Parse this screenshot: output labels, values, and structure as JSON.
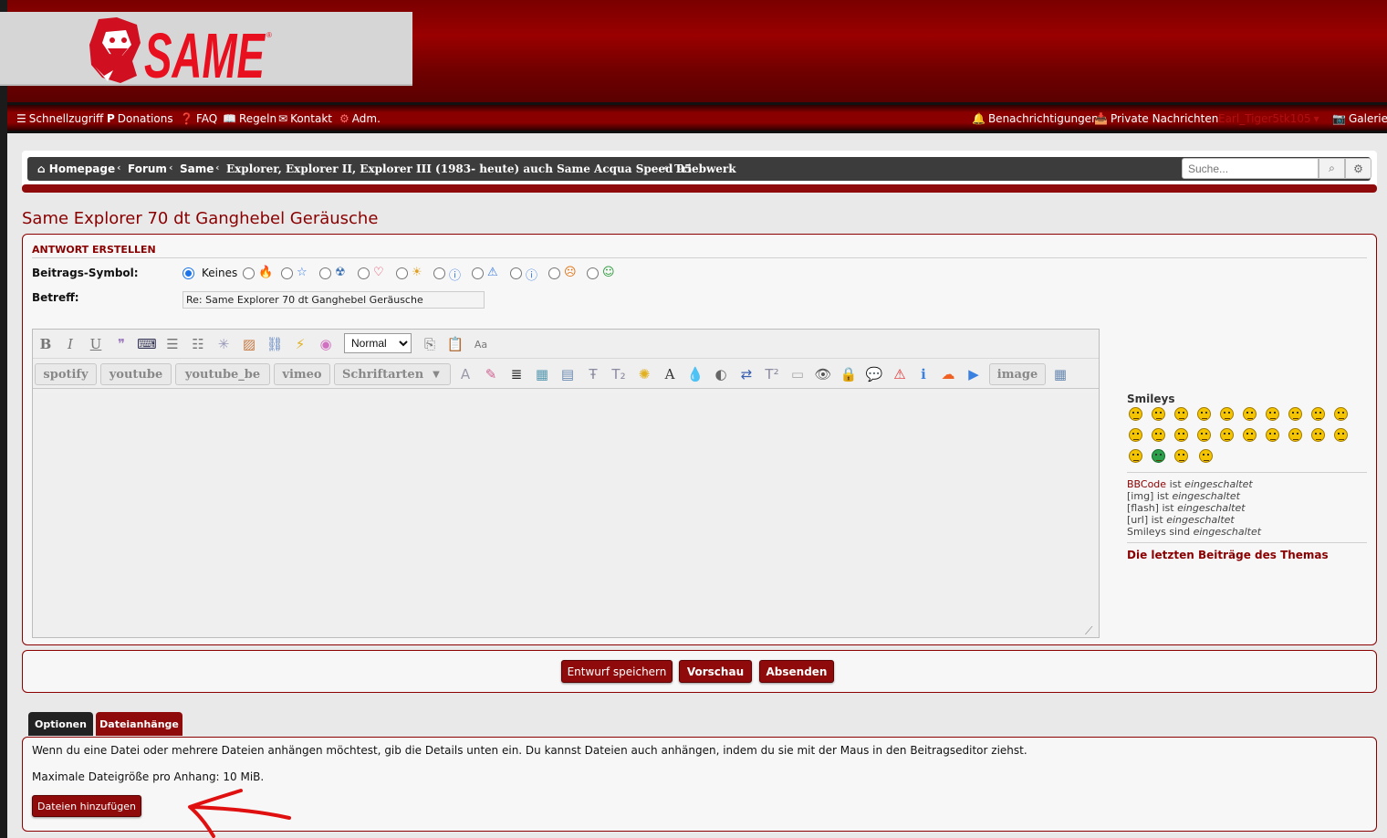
{
  "logo": {
    "text": "SAME"
  },
  "nav": {
    "quick": "Schnellzugriff",
    "donations": "Donations",
    "faq": "FAQ",
    "rules": "Regeln",
    "contact": "Kontakt",
    "admin": "Adm.",
    "notifications": "Benachrichtigungen",
    "pm": "Private Nachrichten",
    "user": "Earl_Tiger5tk105",
    "gallery": "Galerie"
  },
  "breadcrumb": [
    "Homepage",
    "Forum",
    "Same",
    "Explorer, Explorer II, Explorer III (1983- heute) auch Same Acqua Speed 95",
    "Triebwerk"
  ],
  "search": {
    "placeholder": "Suche..."
  },
  "page_title": "Same Explorer 70 dt Ganghebel Geräusche",
  "reply": {
    "header": "ANTWORT ERSTELLEN",
    "icon_label": "Beitrags-Symbol:",
    "icon_none": "Keines",
    "subject_label": "Betreff:",
    "subject_value": "Re: Same Explorer 70 dt Ganghebel Geräusche"
  },
  "toolbar": {
    "font_size": "Normal",
    "spotify": "spotify",
    "youtube": "youtube",
    "youtube_be": "youtube_be",
    "vimeo": "vimeo",
    "fonts": "Schriftarten",
    "image": "image"
  },
  "sidebar": {
    "smileys_title": "Smileys",
    "bbcode_link": "BBCode",
    "bbcode_rest": "ist",
    "img": "[img] ist",
    "flash": "[flash] ist",
    "url": "[url] ist",
    "smileys": "Smileys sind",
    "enabled": "eingeschaltet",
    "last_posts": "Die letzten Beiträge des Themas"
  },
  "buttons": {
    "draft": "Entwurf speichern",
    "preview": "Vorschau",
    "submit": "Absenden"
  },
  "tabs": {
    "options": "Optionen",
    "attachments": "Dateianhänge"
  },
  "attachments": {
    "info": "Wenn du eine Datei oder mehrere Dateien anhängen möchtest, gib die Details unten ein. Du kannst Dateien auch anhängen, indem du sie mit der Maus in den Beitragseditor ziehst.",
    "maxsize": "Maximale Dateigröße pro Anhang: 10 MiB.",
    "add_button": "Dateien hinzufügen"
  },
  "colors": {
    "accent": "#8a0000",
    "button": "#8f0a0a",
    "navbar": "#3c3c3c"
  }
}
